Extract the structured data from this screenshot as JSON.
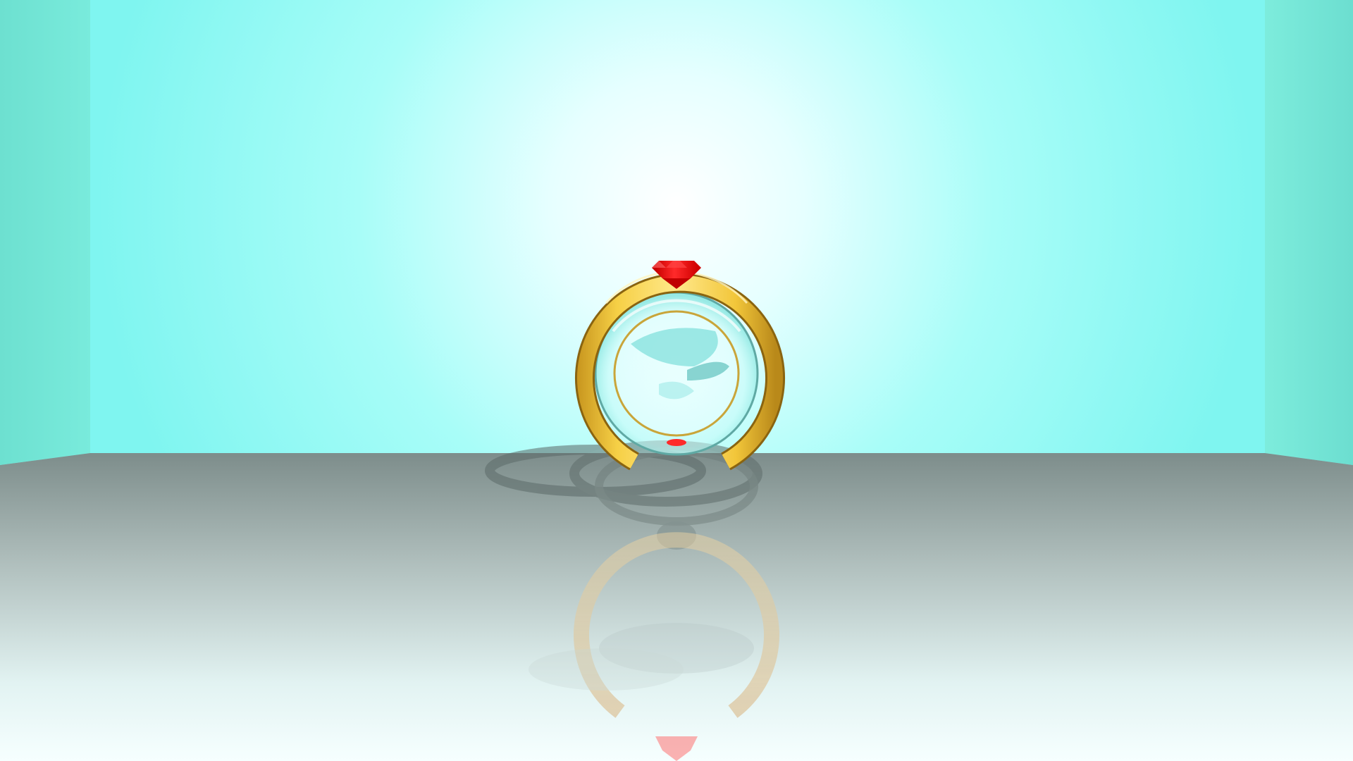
{
  "scene": {
    "objects": [
      "ring",
      "gemstone",
      "glass-cylinder",
      "mirror-floor",
      "room-walls"
    ],
    "colors": {
      "wall_center": "#ffffff",
      "wall_edge": "#7ff5f0",
      "side_wall": "#6ee6d6",
      "floor_top": "#7f8f8d",
      "floor_bottom": "#f4ffff",
      "ring_gold": "#f0c83a",
      "ring_gold_dark": "#b88a18",
      "gem_red": "#ff1a1a",
      "gem_dark": "#c00000",
      "glass_tint": "#9ff2ee"
    }
  }
}
